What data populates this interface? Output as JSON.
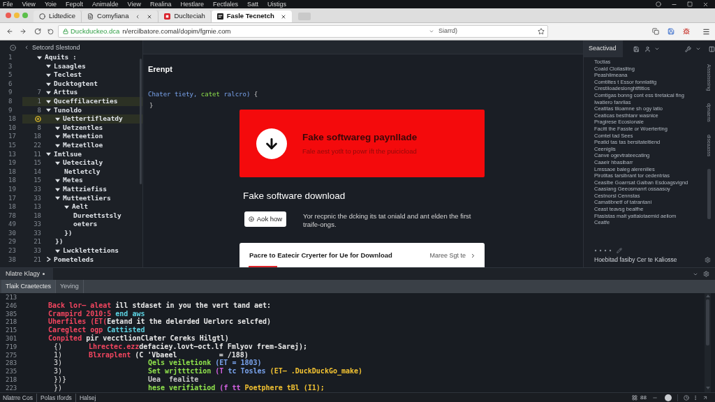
{
  "menu_bar": {
    "items": [
      "File",
      "View",
      "Yoie",
      "Fepolt",
      "Animalde",
      "View",
      "Realina",
      "Hestlare",
      "Fectlales",
      "Satt",
      "Uistigs"
    ]
  },
  "tabs": [
    {
      "title": "Lidtedice",
      "selected": false,
      "closable": false
    },
    {
      "title": "Comyfiana",
      "selected": false,
      "closable": true
    },
    {
      "title": "Duclteciah",
      "selected": false,
      "closable": false
    },
    {
      "title": "Fasle Tecnetch",
      "selected": true,
      "closable": true
    }
  ],
  "address_bar": {
    "site": "Duckduckeo.dca",
    "url": "n/ercilbatore.comal/dopim/fgmie.com",
    "search_text": "Siarrd)"
  },
  "explorer": {
    "title": "Setcord Slestond",
    "items": [
      {
        "label": "Aquits :",
        "line": "1",
        "highlighted": false,
        "breakpoint": false,
        "expanded": true,
        "children": [
          {
            "label": "Lsaagles",
            "line": "3",
            "highlighted": false,
            "breakpoint": false,
            "expanded": true
          },
          {
            "label": "Teclest",
            "line": "5",
            "highlighted": false,
            "breakpoint": false,
            "expanded": true
          },
          {
            "label": "Ducktogtent",
            "line": "6",
            "highlighted": false,
            "breakpoint": false,
            "expanded": true
          },
          {
            "label": "Arttus",
            "line": "9",
            "gutter": "7",
            "highlighted": false,
            "breakpoint": false,
            "expanded": true
          },
          {
            "label": "Quceffilacerties",
            "line": "8",
            "gutter": "1",
            "highlighted": true,
            "breakpoint": false,
            "expanded": true
          },
          {
            "label": "Tunoldo",
            "line": "9",
            "gutter": "8",
            "highlighted": false,
            "breakpoint": false,
            "expanded": true,
            "children": [
              {
                "label": "Uettertifleatdy",
                "line": "18",
                "highlighted": true,
                "breakpoint": true,
                "expanded": true
              },
              {
                "label": "Uetzentles",
                "line": "10",
                "gutter": "8",
                "highlighted": false,
                "breakpoint": false,
                "expanded": true
              },
              {
                "label": "Metteetion",
                "line": "17",
                "gutter": "18",
                "highlighted": false,
                "breakpoint": false,
                "expanded": true
              },
              {
                "label": "Metzetlloe",
                "line": "15",
                "gutter": "22",
                "highlighted": false,
                "breakpoint": false,
                "expanded": true
              }
            ]
          },
          {
            "label": "Imtlsue",
            "line": "13",
            "gutter": "11",
            "highlighted": false,
            "breakpoint": false,
            "expanded": true,
            "children": [
              {
                "label": "Uetecitaly",
                "line": "19",
                "gutter": "15",
                "highlighted": false,
                "breakpoint": false,
                "expanded": true,
                "children": [
                  {
                    "label": "Netletcly",
                    "line": "18",
                    "gutter": "14",
                    "highlighted": false,
                    "breakpoint": false
                  }
                ]
              },
              {
                "label": "Metes",
                "line": "18",
                "gutter": "15",
                "highlighted": false,
                "breakpoint": false,
                "expanded": true
              },
              {
                "label": "Mattziefiss",
                "line": "19",
                "gutter": "33",
                "highlighted": false,
                "breakpoint": false,
                "expanded": true
              },
              {
                "label": "Mutteetliers",
                "line": "17",
                "gutter": "33",
                "highlighted": false,
                "breakpoint": false,
                "expanded": true,
                "children": [
                  {
                    "label": "Aelt",
                    "line": "18",
                    "gutter": "13",
                    "highlighted": false,
                    "breakpoint": false,
                    "expanded": true,
                    "children": [
                      {
                        "label": "Dureettstsly",
                        "line": "78",
                        "gutter": "18",
                        "highlighted": false,
                        "breakpoint": false
                      },
                      {
                        "label": "oeters",
                        "line": "49",
                        "gutter": "33",
                        "highlighted": false,
                        "breakpoint": false
                      }
                    ]
                  },
                  {
                    "label": "})",
                    "line": "30",
                    "gutter": "33",
                    "highlighted": false,
                    "breakpoint": false
                  }
                ]
              },
              {
                "label": "})",
                "line": "29",
                "gutter": "21",
                "highlighted": false,
                "breakpoint": false
              },
              {
                "label": "Lwcklettetions",
                "line": "23",
                "gutter": "33",
                "highlighted": false,
                "breakpoint": false,
                "expanded": true
              }
            ]
          },
          {
            "label": "Pometeleds",
            "line": "38",
            "gutter": "21",
            "highlighted": false,
            "breakpoint": false,
            "expanded": false
          }
        ]
      }
    ]
  },
  "page": {
    "heading": "Erenpt",
    "code": [
      {
        "text": "Chater tiety, ",
        "kind": "value"
      },
      {
        "text": "catet ",
        "kind": "func"
      },
      {
        "text": "ralcro) ",
        "kind": "value"
      },
      {
        "text": "{",
        "kind": "muted"
      }
    ],
    "code_end": "}",
    "banner": {
      "title": "Fake softwareg paynllade",
      "subtitle": "Fale aest yotlt to powr ift the puicicload"
    },
    "title": "Fake software download",
    "button": "Aok how",
    "description": "Yor recpnic the dcking its tat oniald and ant elden the first traife-ongs.",
    "card": {
      "title": "Pacre to Eatecir Cryerter for Ue for Download",
      "link": "Maree Sgt te"
    }
  },
  "side_panel": {
    "tab": "Seactivad",
    "lines": [
      "Toctias",
      "Coald Cloilaslitng",
      "Peashlimeana",
      "Comtiltes t Essor fonnlatitg",
      "Crestiloadeslonghtftitios",
      "Comtigas bonng cont ess tiretaical fing",
      "Iwatiero fanrlias",
      "Ceatitas tiloamne sh ogy latio",
      "Ceaticas besthtanr wasnice",
      "Pragirese Ecosionaie",
      "Facitt the Fasste or Woerterting",
      "Comtel tad Sees",
      "Peatid tas tas bersitateltiend",
      "Ceeniglis",
      "Canve ogevtrateecating",
      "Caaeir hbasibarr",
      "Lmssaoe baleg alerenilies",
      "Pirotitas tarsibrant tor cedentrias",
      "Ceaslbe Goarrsat Gaiban Esdoagsvignd",
      "Caasiang Geeosmanrt ossaasoy",
      "Cestnorsl Cennstas",
      "Camatibnetf of tatrantani",
      "Ceast teavsg bealfhe",
      "Ftasistas malt yattalotaemid aeliom",
      "Ceatfe"
    ],
    "vertical_labels": [
      "Aisssisssing",
      "dpnaens",
      "diseaasss"
    ],
    "footer": "Hoebitad fasiby Cer te Kaliosse"
  },
  "console": {
    "tab": "Nlatre Klagy",
    "subtabs": [
      {
        "label": "Tlaik Craetectes",
        "selected": true
      },
      {
        "label": "Yeving",
        "selected": false
      }
    ],
    "lines": [
      {
        "number": "213",
        "kind": "plain"
      },
      {
        "number": "246",
        "kind": "plain",
        "segments": [
          {
            "text": "Back lor— aleat ",
            "kind": "keyword"
          },
          {
            "text": "ill stdaset in you the vert tand aet:",
            "kind": "plain"
          }
        ]
      },
      {
        "number": "385",
        "kind": "plain",
        "segments": [
          {
            "text": "Crampird 2010:5 ",
            "kind": "keyword"
          },
          {
            "text": "end aws",
            "kind": "name"
          }
        ]
      },
      {
        "number": "218",
        "kind": "plain",
        "segments": [
          {
            "text": "Uherfiles (ET(",
            "kind": "keyword"
          },
          {
            "text": "Eetand it the delerded Uerlorc selcfed)",
            "kind": "plain"
          }
        ]
      },
      {
        "number": "215",
        "kind": "plain",
        "segments": [
          {
            "text": "Careglect ogp ",
            "kind": "keyword"
          },
          {
            "text": "Cattisted",
            "kind": "name"
          }
        ]
      },
      {
        "number": "301",
        "kind": "plain",
        "segments": [
          {
            "text": "Conpited ",
            "kind": "keyword"
          },
          {
            "text": "pir vecctlionClater Cereks Hilgtl)",
            "kind": "plain"
          }
        ]
      },
      {
        "number": "719",
        "kind": "nested",
        "prefix": "{)",
        "segments": [
          {
            "text": "Lhrectec.ezz",
            "kind": "keyword"
          },
          {
            "text": "defaciey.lovt—oct.lf Fmlyov frem-Sarej);",
            "kind": "plain"
          }
        ]
      },
      {
        "number": "275",
        "kind": "nested",
        "prefix": "1)",
        "segments": [
          {
            "text": "Blxraplent ",
            "kind": "keyword"
          },
          {
            "text": "(C 'Vbaeel          = /188)",
            "kind": "plain"
          }
        ]
      },
      {
        "number": "283",
        "kind": "deep",
        "prefix": "3)",
        "segments": [
          {
            "text": "Qels veiletionk ",
            "kind": "func"
          },
          {
            "text": "(ET = 1803)",
            "kind": "value"
          }
        ]
      },
      {
        "number": "235",
        "kind": "deep",
        "prefix": "3)",
        "segments": [
          {
            "text": "Set wrjtttction ",
            "kind": "func"
          },
          {
            "text": "(T ",
            "kind": "param"
          },
          {
            "text": "tc Tosles ",
            "kind": "value"
          },
          {
            "text": "(ET– .DuckDuckGo_make)",
            "kind": "string"
          }
        ]
      },
      {
        "number": "218",
        "kind": "deep",
        "prefix": "})}",
        "segments": [
          {
            "text": "Uea  fealite",
            "kind": "muted"
          }
        ]
      },
      {
        "number": "223",
        "kind": "deep",
        "prefix": "})",
        "segments": [
          {
            "text": "hese verifiatiod ",
            "kind": "func"
          },
          {
            "text": "(f tt ",
            "kind": "param"
          },
          {
            "text": "Poetphere tBl (I1);",
            "kind": "string"
          }
        ]
      }
    ]
  },
  "status_bar": {
    "items": [
      "Nlatrre Cos",
      "Polas Ifords",
      "Halsej"
    ],
    "counter": "88"
  }
}
